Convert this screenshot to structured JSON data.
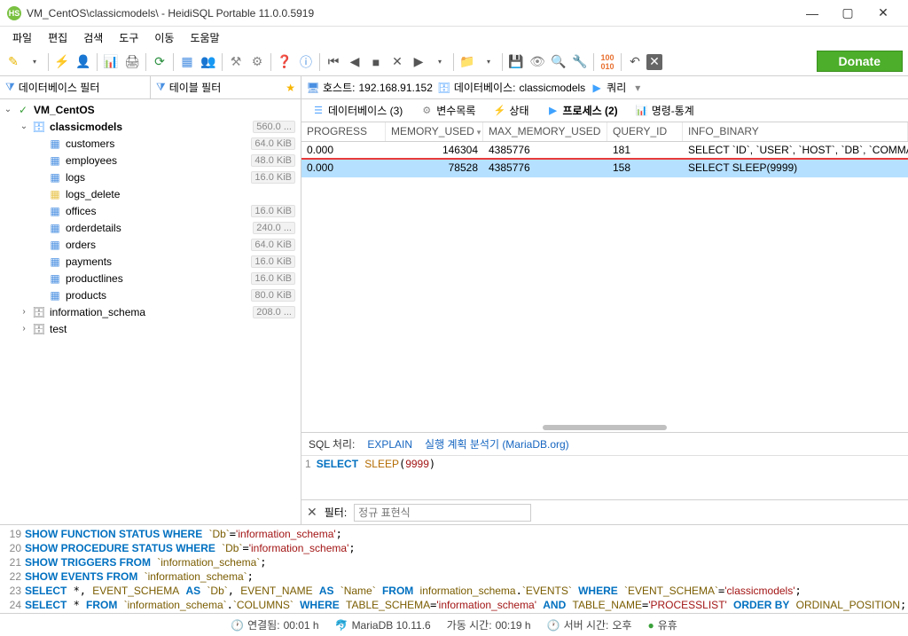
{
  "title": "VM_CentOS\\classicmodels\\ - HeidiSQL Portable 11.0.0.5919",
  "menu": {
    "file": "파일",
    "edit": "편집",
    "search": "검색",
    "tools": "도구",
    "go": "이동",
    "help": "도움말"
  },
  "donate": "Donate",
  "filters": {
    "db": "데이터베이스 필터",
    "table": "테이블 필터"
  },
  "crumbs": {
    "host_label": "호스트:",
    "host": "192.168.91.152",
    "db_label": "데이터베이스:",
    "db": "classicmodels",
    "query": "쿼리"
  },
  "tree": {
    "conn": "VM_CentOS",
    "db": "classicmodels",
    "db_size": "560.0 ...",
    "tables": [
      {
        "name": "customers",
        "size": "64.0 KiB"
      },
      {
        "name": "employees",
        "size": "48.0 KiB"
      },
      {
        "name": "logs",
        "size": "16.0 KiB"
      },
      {
        "name": "logs_delete",
        "size": ""
      },
      {
        "name": "offices",
        "size": "16.0 KiB"
      },
      {
        "name": "orderdetails",
        "size": "240.0 ..."
      },
      {
        "name": "orders",
        "size": "64.0 KiB"
      },
      {
        "name": "payments",
        "size": "16.0 KiB"
      },
      {
        "name": "productlines",
        "size": "16.0 KiB"
      },
      {
        "name": "products",
        "size": "80.0 KiB"
      }
    ],
    "info_schema": "information_schema",
    "info_schema_size": "208.0 ...",
    "test": "test"
  },
  "tabs": {
    "database": "데이터베이스 (3)",
    "variables": "변수목록",
    "status": "상태",
    "process": "프로세스 (2)",
    "stats": "명령-통계"
  },
  "grid": {
    "headers": {
      "progress": "PROGRESS",
      "memory_used": "MEMORY_USED",
      "max_memory_used": "MAX_MEMORY_USED",
      "query_id": "QUERY_ID",
      "info_binary": "INFO_BINARY"
    },
    "rows": [
      {
        "progress": "0.000",
        "memory_used": "146304",
        "max_memory_used": "4385776",
        "query_id": "181",
        "info_binary": "SELECT `ID`, `USER`, `HOST`, `DB`, `COMMAN"
      },
      {
        "progress": "0.000",
        "memory_used": "78528",
        "max_memory_used": "4385776",
        "query_id": "158",
        "info_binary": "SELECT SLEEP(9999)"
      }
    ]
  },
  "sql": {
    "label": "SQL 처리:",
    "explain": "EXPLAIN",
    "analyze": "실행 계획 분석기 (MariaDB.org)",
    "line_no": "1"
  },
  "filter2": {
    "label": "필터:",
    "placeholder": "정규 표현식"
  },
  "status": {
    "connected_lbl": "연결됨:",
    "connected": "00:01 h",
    "server_ver": "MariaDB 10.11.6",
    "uptime_lbl": "가동 시간:",
    "uptime": "00:19 h",
    "server_time_lbl": "서버 시간:",
    "server_time": "오후",
    "idle": "유휴"
  }
}
